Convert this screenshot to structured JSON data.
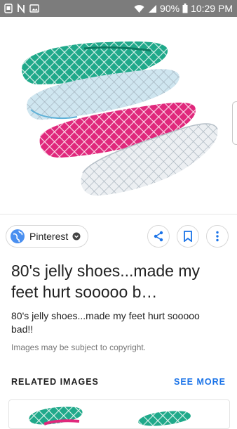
{
  "status_bar": {
    "battery_text": "90%",
    "time": "10:29 PM"
  },
  "image": {
    "alt": "80's jelly shoes...made my feet hurt sooooo bad!!",
    "colors": {
      "green": "#1fa98a",
      "clear_blue": "#cfe6f0",
      "pink": "#e0287c",
      "clear": "#eceff2"
    }
  },
  "source": {
    "name": "Pinterest"
  },
  "actions": {
    "share": "share-icon",
    "save": "bookmark-icon",
    "more": "more-vert-icon"
  },
  "content": {
    "title": "80's jelly shoes...made my feet hurt sooooo b…",
    "description": "80's jelly shoes...made my feet hurt sooooo bad!!",
    "copyright": "Images may be subject to copyright."
  },
  "related": {
    "header": "RELATED IMAGES",
    "see_more": "SEE MORE"
  },
  "theme": {
    "accent": "#1a73e8",
    "status_bar": "#7c7c7c"
  }
}
